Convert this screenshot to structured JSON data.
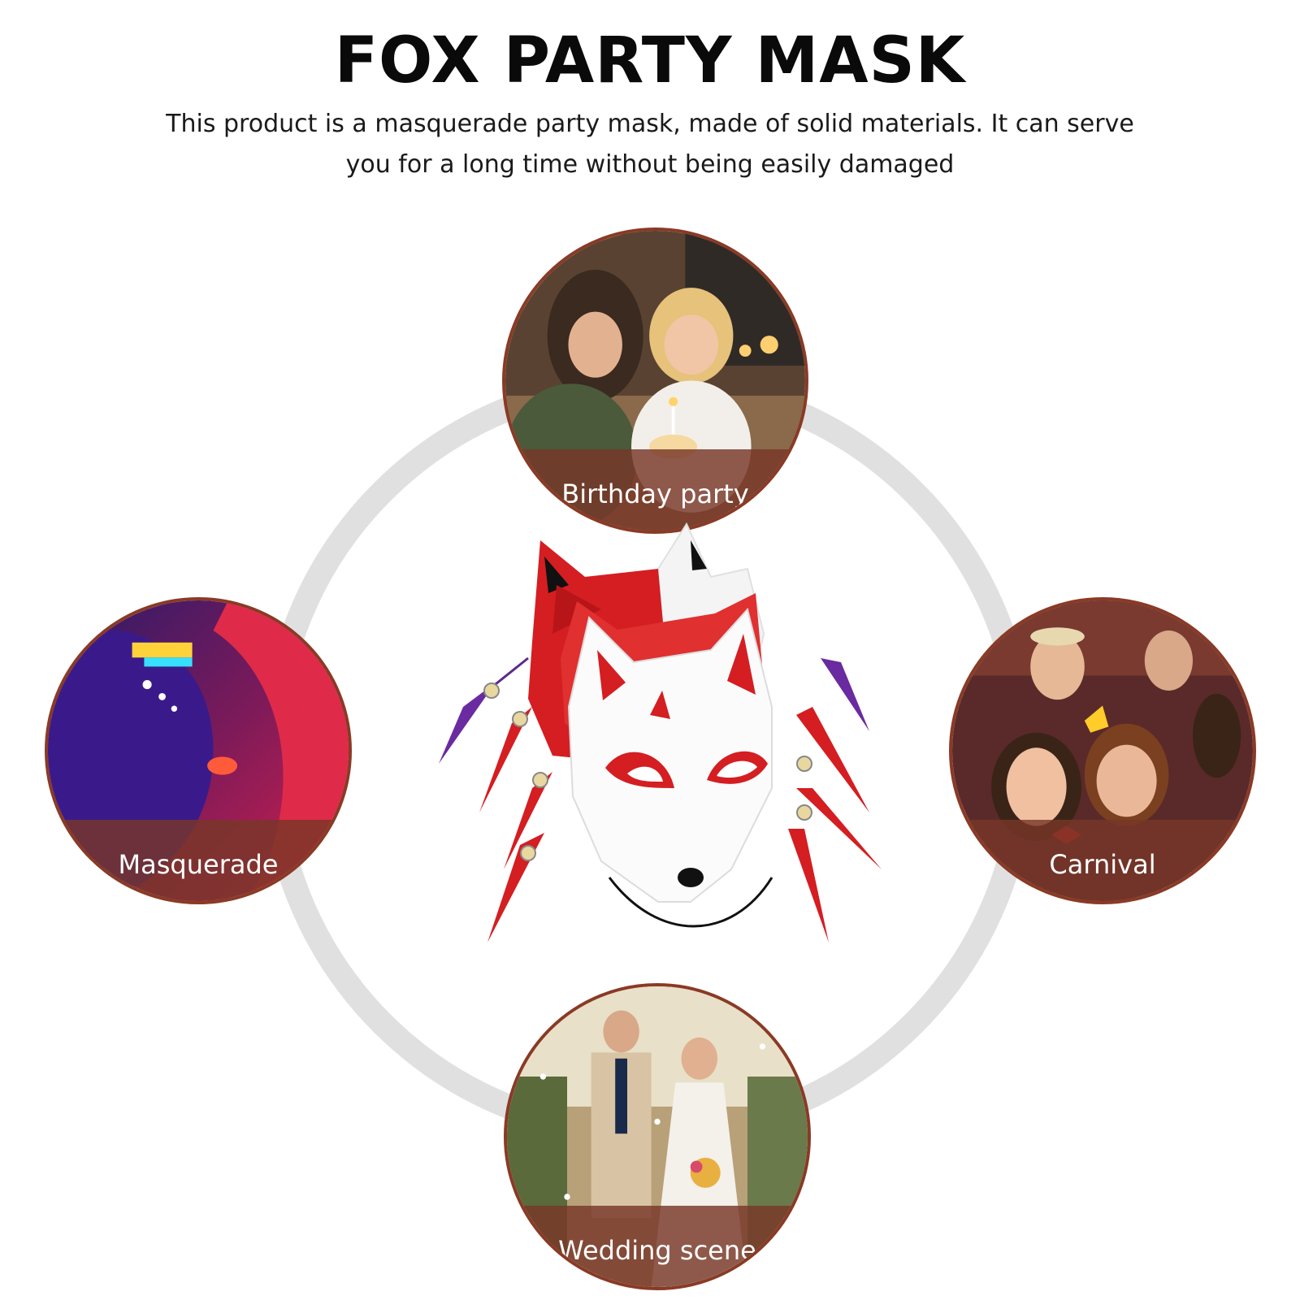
{
  "header": {
    "title": "FOX PARTY MASK",
    "description_line1": "This product is a masquerade party mask, made of solid materials. It can serve",
    "description_line2": "you for a long time without being easily damaged"
  },
  "scenes": [
    {
      "label": "Birthday party",
      "image": "birthday-photo"
    },
    {
      "label": "Masquerade",
      "image": "masquerade-photo"
    },
    {
      "label": "Carnival",
      "image": "carnival-photo"
    },
    {
      "label": "Wedding scene",
      "image": "wedding-photo"
    }
  ],
  "product": {
    "image": "fox-mask-stack"
  },
  "colors": {
    "accent_red": "#d42020",
    "label_band": "#7a3a28",
    "ring": "#e0e0e0"
  }
}
